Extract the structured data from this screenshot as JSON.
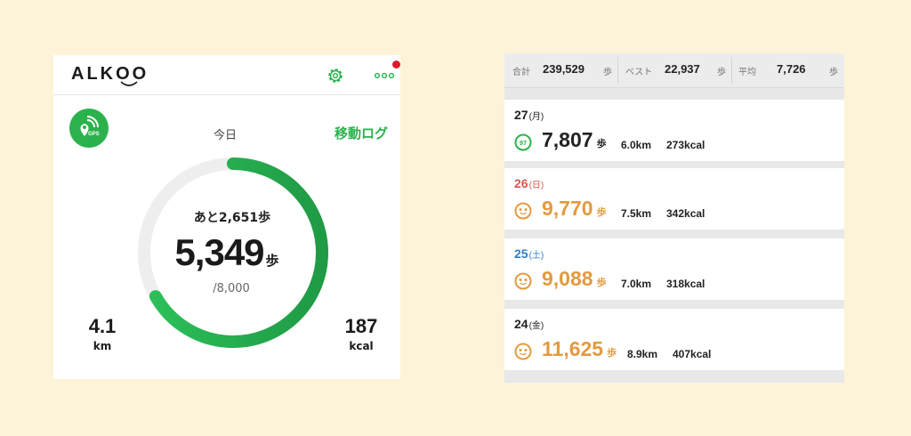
{
  "colors": {
    "page_bg": "#fdf3d8",
    "accent_green": "#2bb24c",
    "achieved_orange": "#e39a3f",
    "saturday_blue": "#2f7fc4",
    "sunday_red": "#d9574a",
    "notification_red": "#e01a2b"
  },
  "left": {
    "logo": "ALKOO",
    "header_icons": [
      "gear-icon",
      "more-dots-icon"
    ],
    "gps_badge": "GPS",
    "today_label": "今日",
    "move_log_label": "移動ログ",
    "remaining_text": "あと2,651歩",
    "steps": "5,349",
    "steps_unit": "歩",
    "goal": "/8,000",
    "progress_fraction": 0.668,
    "distance_value": "4.1",
    "distance_unit": "km",
    "calories_value": "187",
    "calories_unit": "kcal"
  },
  "right": {
    "summary": [
      {
        "label": "合計",
        "value": "239,529",
        "unit": "歩"
      },
      {
        "label": "ベスト",
        "value": "22,937",
        "unit": "歩"
      },
      {
        "label": "平均",
        "value": "7,726",
        "unit": "歩"
      }
    ],
    "days": [
      {
        "date": "27",
        "dow": "(月)",
        "steps": "7,807",
        "unit": "歩",
        "distance": "6.0km",
        "kcal": "273kcal",
        "icon": "progress-97-icon",
        "icon_label": "97",
        "achieved": false,
        "date_color": "#222222",
        "steps_color": "#222222"
      },
      {
        "date": "26",
        "dow": "(日)",
        "steps": "9,770",
        "unit": "歩",
        "distance": "7.5km",
        "kcal": "342kcal",
        "icon": "smile-face-icon",
        "achieved": true,
        "date_color": "#d9574a",
        "steps_color": "#e39a3f"
      },
      {
        "date": "25",
        "dow": "(土)",
        "steps": "9,088",
        "unit": "歩",
        "distance": "7.0km",
        "kcal": "318kcal",
        "icon": "smile-face-icon",
        "achieved": true,
        "date_color": "#2f7fc4",
        "steps_color": "#e39a3f"
      },
      {
        "date": "24",
        "dow": "(金)",
        "steps": "11,625",
        "unit": "歩",
        "distance": "8.9km",
        "kcal": "407kcal",
        "icon": "smile-face-icon",
        "achieved": true,
        "date_color": "#222222",
        "steps_color": "#e39a3f"
      }
    ]
  }
}
